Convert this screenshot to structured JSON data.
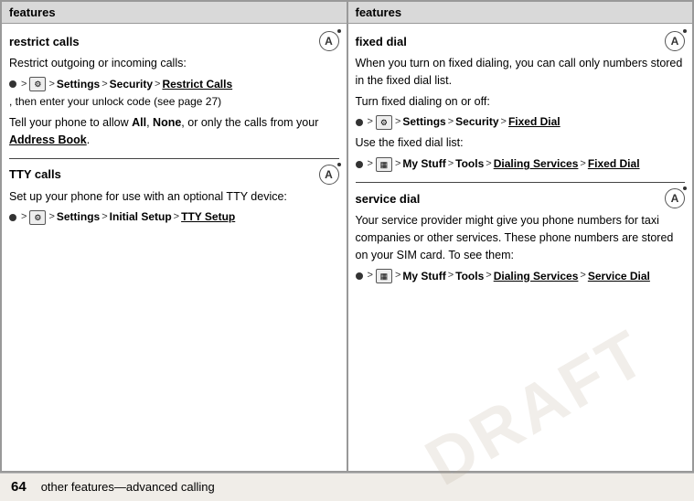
{
  "left_panel": {
    "header": "features",
    "sections": [
      {
        "id": "restrict-calls",
        "title": "restrict calls",
        "has_icon": true,
        "content_paragraphs": [
          "Restrict outgoing or incoming calls:"
        ],
        "nav_paths": [
          {
            "id": "nav1",
            "items": [
              "dot",
              "icon_settings",
              "arrow",
              "Settings",
              "arrow",
              "Security",
              "arrow",
              "Restrict Calls",
              "text_then",
              "then enter your unlock code (see page 27)"
            ]
          }
        ],
        "extra_paragraphs": [
          "Tell your phone to allow All, None, or only the calls from your Address Book."
        ]
      },
      {
        "id": "tty-calls",
        "title": "TTY calls",
        "has_icon": true,
        "content_paragraphs": [
          "Set up your phone for use with an optional TTY device:"
        ],
        "nav_paths": [
          {
            "id": "nav2",
            "items": [
              "dot",
              "icon_settings",
              "arrow",
              "Settings",
              "arrow",
              "Initial Setup",
              "arrow",
              "TTY Setup"
            ]
          }
        ]
      }
    ]
  },
  "right_panel": {
    "header": "features",
    "sections": [
      {
        "id": "fixed-dial",
        "title": "fixed dial",
        "has_icon": true,
        "content_paragraphs": [
          "When you turn on fixed dialing, you can call only numbers stored in the fixed dial list.",
          "Turn fixed dialing on or off:"
        ],
        "nav_paths": [
          {
            "id": "nav3",
            "items": [
              "dot",
              "icon_settings",
              "arrow",
              "Settings",
              "arrow",
              "Security",
              "arrow",
              "Fixed Dial"
            ]
          }
        ],
        "extra_paragraphs": [
          "Use the fixed dial list:"
        ],
        "nav_paths2": [
          {
            "id": "nav4",
            "items": [
              "dot",
              "icon_mystuff",
              "arrow",
              "My Stuff",
              "arrow",
              "Tools",
              "arrow",
              "Dialing Services",
              "arrow",
              "Fixed Dial"
            ]
          }
        ]
      },
      {
        "id": "service-dial",
        "title": "service dial",
        "has_icon": true,
        "content_paragraphs": [
          "Your service provider might give you phone numbers for taxi companies or other services. These phone numbers are stored on your SIM card. To see them:"
        ],
        "nav_paths": [
          {
            "id": "nav5",
            "items": [
              "dot",
              "icon_mystuff",
              "arrow",
              "My Stuff",
              "arrow",
              "Tools",
              "arrow",
              "Dialing Services",
              "arrow",
              "Service Dial"
            ]
          }
        ]
      }
    ]
  },
  "footer": {
    "page_number": "64",
    "description": "other features—advanced calling"
  },
  "watermark": "DRAFT"
}
